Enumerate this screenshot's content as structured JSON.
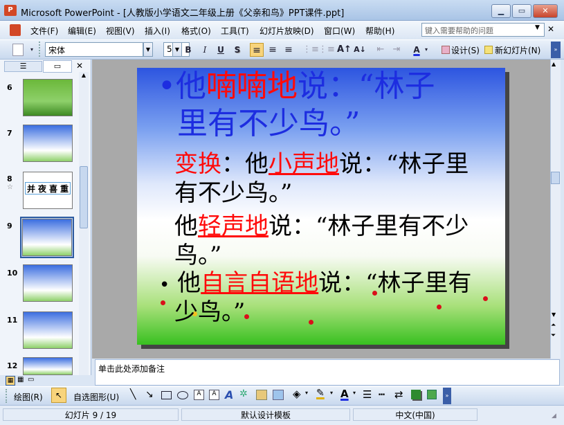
{
  "window": {
    "title": "Microsoft PowerPoint - [人教版小学语文二年级上册《父亲和鸟》PPT课件.ppt]",
    "app_icon_text": "P",
    "minimize": "▁",
    "restore": "▭",
    "close": "✕"
  },
  "menu": {
    "items": [
      "文件(F)",
      "编辑(E)",
      "视图(V)",
      "插入(I)",
      "格式(O)",
      "工具(T)",
      "幻灯片放映(D)",
      "窗口(W)",
      "帮助(H)"
    ],
    "help_placeholder": "键入需要帮助的问题",
    "doc_close": "✕"
  },
  "toolbar": {
    "font": "宋体",
    "size": "54",
    "bold": "B",
    "italic": "I",
    "underline": "U",
    "shadow": "S",
    "design_label": "设计(S)",
    "new_slide_label": "新幻灯片(N)"
  },
  "thumbnails": {
    "numbers": [
      "6",
      "7",
      "8",
      "9",
      "10",
      "11",
      "12"
    ],
    "thumb8_chars": [
      "并",
      "夜",
      "喜",
      "重"
    ]
  },
  "slide": {
    "line1_a": "他",
    "line1_b": "喃喃地",
    "line1_c": "说：“林子",
    "line2": "里有不少鸟。”",
    "line3_a": "变换",
    "line3_b": "：他",
    "line3_c": "小声地",
    "line3_d": "说：“林子里",
    "line4": "有不少鸟。”",
    "line5_a": "他",
    "line5_b": "轻声地",
    "line5_c": "说：“林子里有不少",
    "line6": "鸟。”",
    "line7_a": "他",
    "line7_b": "自言自语地",
    "line7_c": "说：“林子里有",
    "line8": "少鸟。”",
    "bullet": "•"
  },
  "notes": {
    "placeholder": "单击此处添加备注"
  },
  "drawbar": {
    "draw_label": "绘图(R)",
    "autoshape_label": "自选图形(U)"
  },
  "status": {
    "slide_pos": "幻灯片 9 / 19",
    "template": "默认设计模板",
    "language": "中文(中国)"
  },
  "colors": {
    "title_blue": "#1d2de0",
    "accent_red": "#ff0b0b"
  }
}
